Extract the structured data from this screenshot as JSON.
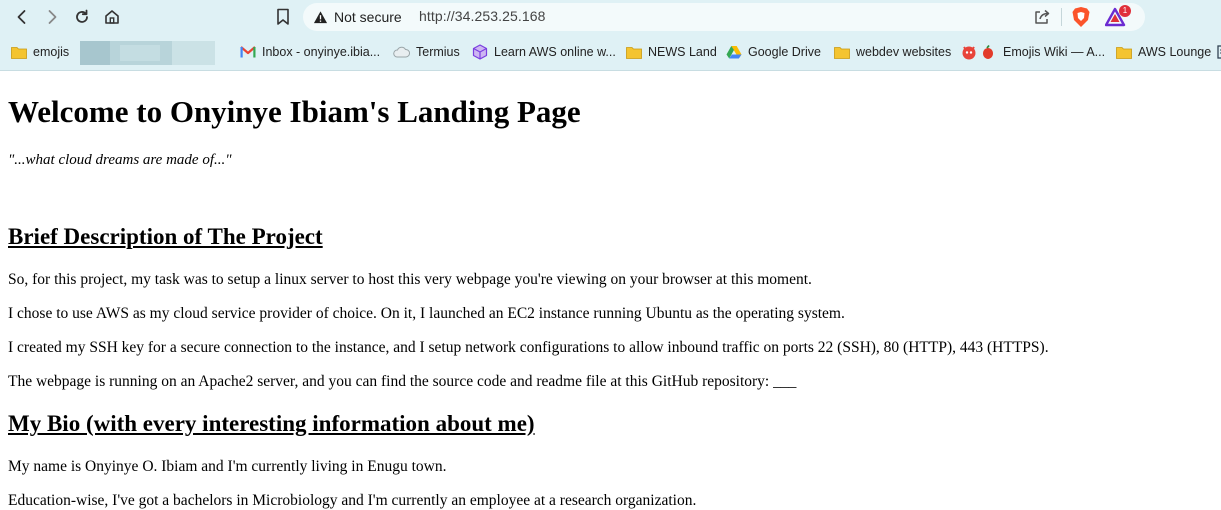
{
  "browser": {
    "security_label": "Not secure",
    "url": "http://34.253.25.168",
    "rewards_badge": "1",
    "colors": {
      "chrome_bg": "#dff1f5",
      "brave_orange": "#fb542b",
      "rewards_red": "#e0303a"
    }
  },
  "bookmarks": [
    {
      "label": "emojis",
      "icon": "folder-icon"
    },
    {
      "label": "Inbox - onyinye.ibia...",
      "icon": "gmail-icon"
    },
    {
      "label": "Termius",
      "icon": "termius-icon"
    },
    {
      "label": "Learn AWS online w...",
      "icon": "cube-icon"
    },
    {
      "label": "NEWS Land",
      "icon": "folder-icon"
    },
    {
      "label": "Google Drive",
      "icon": "google-drive-icon"
    },
    {
      "label": "webdev websites",
      "icon": "folder-icon"
    },
    {
      "label": "Emojis Wiki — A...",
      "icon": "emoji-icon"
    },
    {
      "label": "AWS Lounge",
      "icon": "folder-icon"
    }
  ],
  "page": {
    "title": "Welcome to Onyinye Ibiam's Landing Page",
    "tagline": "\"...what cloud dreams are made of...\"",
    "section1": {
      "heading": "Brief Description of The Project",
      "paragraphs": [
        "So, for this project, my task was to setup a linux server to host this very webpage you're viewing on your browser at this moment.",
        "I chose to use AWS as my cloud service provider of choice. On it, I launched an EC2 instance running Ubuntu as the operating system.",
        "I created my SSH key for a secure connection to the instance, and I setup network configurations to allow inbound traffic on ports 22 (SSH), 80 (HTTP), 443 (HTTPS).",
        "The webpage is running on an Apache2 server, and you can find the source code and readme file at this GitHub repository: ___"
      ]
    },
    "section2": {
      "heading": "My Bio (with every interesting information about me)",
      "paragraphs": [
        "My name is Onyinye O. Ibiam and I'm currently living in Enugu town.",
        "Education-wise, I've got a bachelors in Microbiology and I'm currently an employee at a research organization."
      ]
    }
  }
}
